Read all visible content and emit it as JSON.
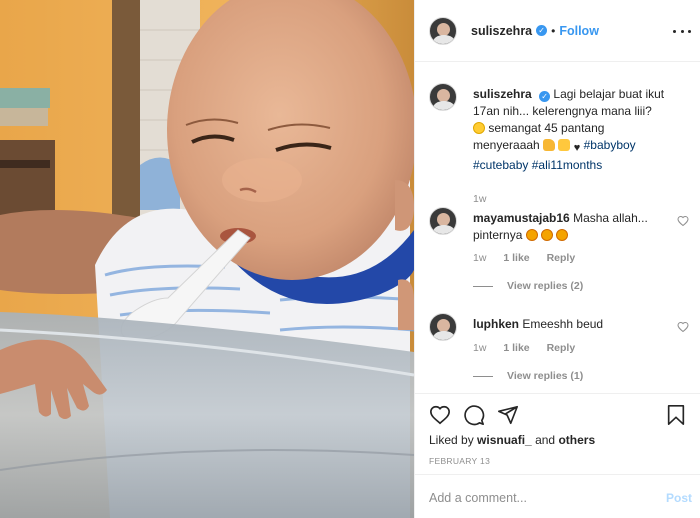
{
  "header": {
    "username": "suliszehra",
    "verified_icon": "verified-badge-icon",
    "separator": "•",
    "follow_label": "Follow",
    "more_icon": "more-options-icon"
  },
  "caption": {
    "username": "suliszehra",
    "text_1": "Lagi belajar buat ikut 17an nih... kelerengnya mana liii?",
    "text_2": "semangat 45 pantang menyeraaah",
    "hashtags": [
      "#babyboy",
      "#cutebaby",
      "#ali11months"
    ],
    "time": "1w"
  },
  "comments": [
    {
      "username": "mayamustajab16",
      "text": "Masha allah... pinternya",
      "time": "1w",
      "likes": "1 like",
      "reply_label": "Reply",
      "view_replies": "View replies (2)"
    },
    {
      "username": "luphken",
      "text": "Emeeshh beud",
      "time": "1w",
      "likes": "1 like",
      "reply_label": "Reply",
      "view_replies": "View replies (1)"
    }
  ],
  "actions": {
    "icons": [
      "heart-icon",
      "comment-icon",
      "share-icon",
      "bookmark-icon"
    ],
    "liked_prefix": "Liked by",
    "liked_user": "wisnuafi_",
    "liked_and": "and",
    "liked_others": "others",
    "date": "February 13"
  },
  "add_comment": {
    "placeholder": "Add a comment...",
    "post_label": "Post"
  },
  "colors": {
    "link": "#3897f0",
    "muted": "#8e8e8e",
    "text": "#262626",
    "post_disabled": "#b3dbff"
  }
}
